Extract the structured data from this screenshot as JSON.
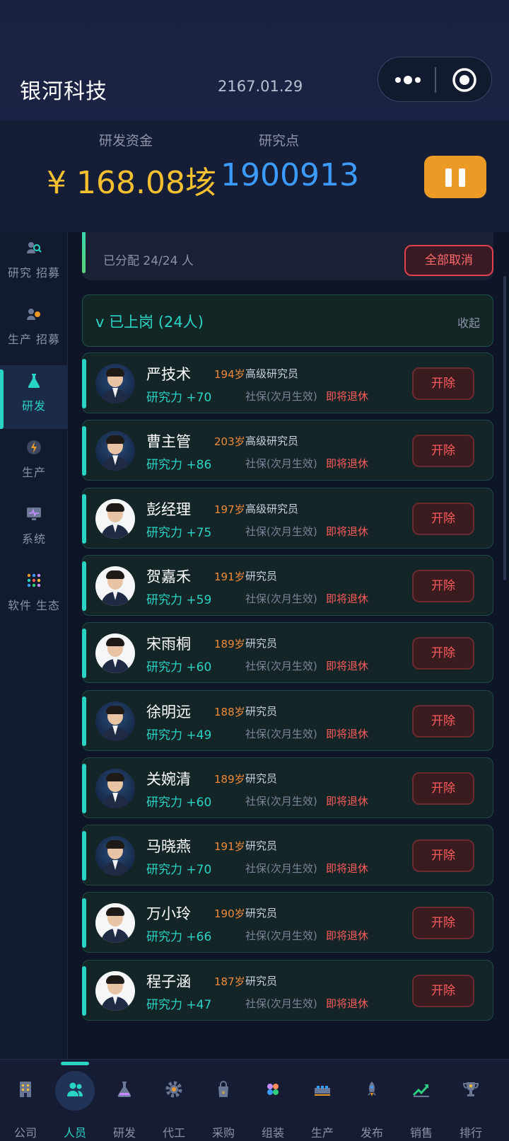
{
  "header": {
    "app_title": "银河科技",
    "date": "2167.01.29"
  },
  "funds": {
    "rd_funds_label": "研发资金",
    "research_points_label": "研究点",
    "rd_funds_value": "¥ 168.08垓",
    "research_points_value": "1900913"
  },
  "sidebar": {
    "items": [
      {
        "label": "研究 招募",
        "icon": "research-recruit-icon"
      },
      {
        "label": "生产 招募",
        "icon": "production-recruit-icon"
      },
      {
        "label": "研发",
        "icon": "flask-icon",
        "active": true
      },
      {
        "label": "生产",
        "icon": "production-icon"
      },
      {
        "label": "系统",
        "icon": "system-icon"
      },
      {
        "label": "软件 生态",
        "icon": "app-grid-icon"
      }
    ]
  },
  "summary": {
    "assigned": "已分配 24/24 人",
    "cancel_all": "全部取消"
  },
  "section": {
    "title": "v 已上岗 (24人)",
    "collapse": "收起"
  },
  "employees": [
    {
      "name": "严技术",
      "age": "194岁",
      "title": "高级研究员",
      "power": "研究力 +70",
      "insurance": "社保(次月生效)",
      "status": "即将退休",
      "fire": "开除"
    },
    {
      "name": "曹主管",
      "age": "203岁",
      "title": "高级研究员",
      "power": "研究力 +86",
      "insurance": "社保(次月生效)",
      "status": "即将退休",
      "fire": "开除"
    },
    {
      "name": "彭经理",
      "age": "197岁",
      "title": "高级研究员",
      "power": "研究力 +75",
      "insurance": "社保(次月生效)",
      "status": "即将退休",
      "fire": "开除"
    },
    {
      "name": "贺嘉禾",
      "age": "191岁",
      "title": "研究员",
      "power": "研究力 +59",
      "insurance": "社保(次月生效)",
      "status": "即将退休",
      "fire": "开除"
    },
    {
      "name": "宋雨桐",
      "age": "189岁",
      "title": "研究员",
      "power": "研究力 +60",
      "insurance": "社保(次月生效)",
      "status": "即将退休",
      "fire": "开除"
    },
    {
      "name": "徐明远",
      "age": "188岁",
      "title": "研究员",
      "power": "研究力 +49",
      "insurance": "社保(次月生效)",
      "status": "即将退休",
      "fire": "开除"
    },
    {
      "name": "关婉清",
      "age": "189岁",
      "title": "研究员",
      "power": "研究力 +60",
      "insurance": "社保(次月生效)",
      "status": "即将退休",
      "fire": "开除"
    },
    {
      "name": "马晓燕",
      "age": "191岁",
      "title": "研究员",
      "power": "研究力 +70",
      "insurance": "社保(次月生效)",
      "status": "即将退休",
      "fire": "开除"
    },
    {
      "name": "万小玲",
      "age": "190岁",
      "title": "研究员",
      "power": "研究力 +66",
      "insurance": "社保(次月生效)",
      "status": "即将退休",
      "fire": "开除"
    },
    {
      "name": "程子涵",
      "age": "187岁",
      "title": "研究员",
      "power": "研究力 +47",
      "insurance": "社保(次月生效)",
      "status": "即将退休",
      "fire": "开除"
    }
  ],
  "bottom_nav": {
    "items": [
      {
        "label": "公司",
        "icon": "building-icon"
      },
      {
        "label": "人员",
        "icon": "people-icon",
        "active": true
      },
      {
        "label": "研发",
        "icon": "flask-icon"
      },
      {
        "label": "代工",
        "icon": "gear-icon"
      },
      {
        "label": "采购",
        "icon": "shopping-bag-icon"
      },
      {
        "label": "组装",
        "icon": "assembly-icon"
      },
      {
        "label": "生产",
        "icon": "factory-icon"
      },
      {
        "label": "发布",
        "icon": "rocket-icon"
      },
      {
        "label": "销售",
        "icon": "trend-icon"
      },
      {
        "label": "排行",
        "icon": "trophy-icon"
      }
    ]
  },
  "colors": {
    "accent": "#2ad4c5",
    "money": "#f5c030",
    "points": "#3c9bff",
    "danger": "#ff5b5b",
    "pause": "#eb9a26"
  }
}
